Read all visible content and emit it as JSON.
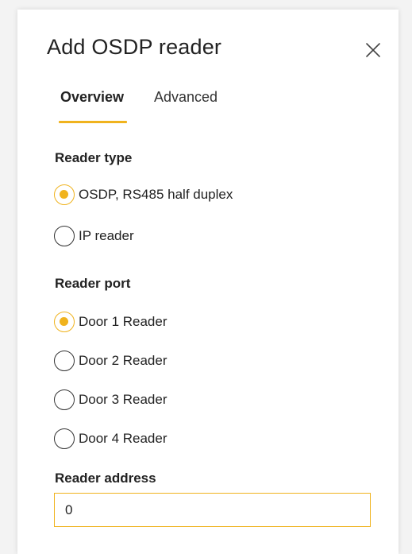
{
  "dialog": {
    "title": "Add OSDP reader",
    "close_icon": "close-icon"
  },
  "tabs": [
    {
      "label": "Overview",
      "active": true
    },
    {
      "label": "Advanced",
      "active": false
    }
  ],
  "reader_type": {
    "label": "Reader type",
    "options": [
      {
        "label": "OSDP, RS485 half duplex",
        "checked": true
      },
      {
        "label": "IP reader",
        "checked": false
      }
    ]
  },
  "reader_port": {
    "label": "Reader port",
    "options": [
      {
        "label": "Door 1 Reader",
        "checked": true
      },
      {
        "label": "Door 2 Reader",
        "checked": false
      },
      {
        "label": "Door 3 Reader",
        "checked": false
      },
      {
        "label": "Door 4 Reader",
        "checked": false
      }
    ]
  },
  "reader_address": {
    "label": "Reader address",
    "value": "0"
  },
  "colors": {
    "accent": "#f0b31e",
    "text": "#222222",
    "panel": "#ffffff",
    "background": "#f3f3f3"
  }
}
